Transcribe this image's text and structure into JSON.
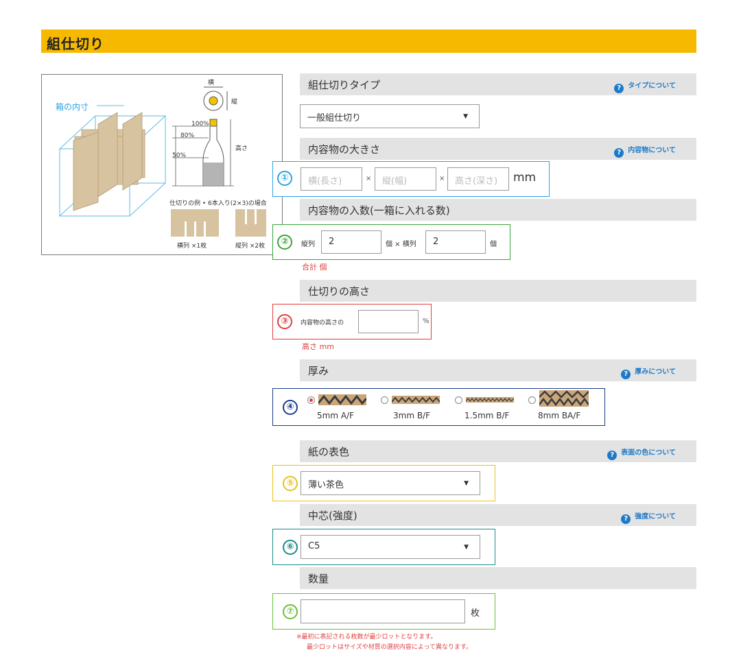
{
  "title": "組仕切り",
  "diagram": {
    "inner_label": "箱の内寸",
    "width_label": "横",
    "depth_label": "縦",
    "height_label": "高さ",
    "pct100": "100%",
    "pct80": "80%",
    "pct50": "50%",
    "example_caption": "仕切りの例 • 6本入り(2×3)の場合",
    "piece1_caption": "横列 ×1枚",
    "piece2_caption": "縦列 ×2枚"
  },
  "sections": {
    "type": {
      "label": "組仕切りタイプ",
      "help": "タイプについて",
      "selected": "一般組仕切り"
    },
    "size": {
      "label": "内容物の大きさ",
      "help": "内容物について",
      "number": "①",
      "w_placeholder": "横(長さ)",
      "d_placeholder": "縦(幅)",
      "h_placeholder": "高さ(深さ)",
      "times": "×",
      "unit": "mm"
    },
    "count": {
      "label": "内容物の入数(一箱に入れる数)",
      "number": "②",
      "tate_label": "縦列",
      "tate_value": "2",
      "mid_label": "個 × 横列",
      "yoko_value": "2",
      "end_label": "個",
      "total": "合計 個"
    },
    "height": {
      "label": "仕切りの高さ",
      "number": "③",
      "prefix": "内容物の高さの",
      "unit": "%",
      "result": "高さ mm"
    },
    "thickness": {
      "label": "厚み",
      "help": "厚みについて",
      "number": "④",
      "options": [
        "5mm A/F",
        "3mm B/F",
        "1.5mm B/F",
        "8mm BA/F"
      ],
      "selected": "5mm A/F"
    },
    "color": {
      "label": "紙の表色",
      "help": "表面の色について",
      "number": "⑤",
      "selected": "薄い茶色"
    },
    "core": {
      "label": "中芯(強度)",
      "help": "強度について",
      "number": "⑥",
      "selected": "C5"
    },
    "qty": {
      "label": "数量",
      "number": "⑦",
      "unit": "枚",
      "note1": "※最初に表記される枚数が最少ロットとなります。",
      "note2": "最少ロットはサイズや材質の選択内容によって異なります。"
    }
  },
  "colors": {
    "title_bar": "#f6b900",
    "help_blue": "#1d7ac8",
    "c1": "#2ba4e0",
    "c2": "#3aa23a",
    "c3": "#e03e3e",
    "c4": "#1b3a8a",
    "c5": "#e8c11a",
    "c6": "#1a8a8a",
    "c7": "#6cbf3a"
  }
}
